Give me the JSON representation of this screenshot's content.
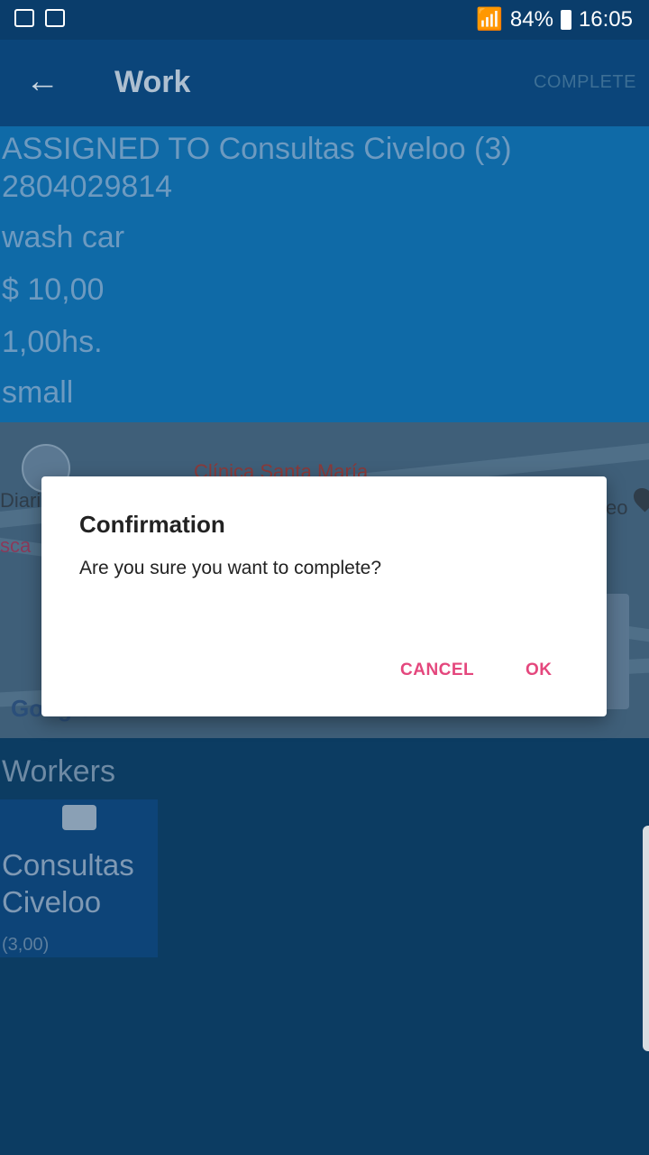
{
  "status": {
    "battery": "84%",
    "time": "16:05"
  },
  "appbar": {
    "back_icon": "←",
    "title": "Work",
    "complete_label": "COMPLETE"
  },
  "details": {
    "assigned": "ASSIGNED TO Consultas Civeloo (3)",
    "phone": "2804029814",
    "service": "wash car",
    "price": "$ 10,00",
    "duration": "1,00hs.",
    "size": "small"
  },
  "map": {
    "label_clinic": "Clínica Santa María",
    "label_left1": "Diario",
    "label_left2": "sca",
    "label_right": "eo",
    "google_logo": "Google"
  },
  "workers": {
    "title": "Workers",
    "items": [
      {
        "name": "Consultas Civeloo",
        "rating": "(3,00)"
      }
    ]
  },
  "dialog": {
    "title": "Confirmation",
    "message": "Are you sure you want to complete?",
    "cancel_label": "CANCEL",
    "ok_label": "OK"
  }
}
